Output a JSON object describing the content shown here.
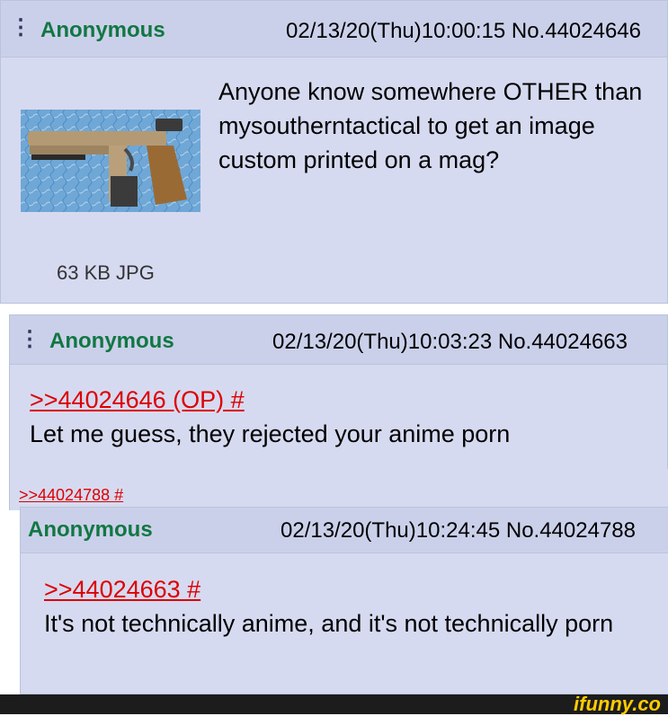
{
  "posts": [
    {
      "name": "Anonymous",
      "datetime": "02/13/20(Thu)10:00:15",
      "number": "No.44024646",
      "text": "Anyone know somewhere OTHER than mysoutherntactical to get an image custom printed on a mag?",
      "file": "63 KB JPG"
    },
    {
      "name": "Anonymous",
      "datetime": "02/13/20(Thu)10:03:23",
      "number": "No.44024663",
      "quote": ">>44024646 (OP) #",
      "text": "Let me guess, they rejected your anime porn",
      "backlink": ">>44024788 #"
    },
    {
      "name": "Anonymous",
      "datetime": "02/13/20(Thu)10:24:45",
      "number": "No.44024788",
      "quote": ">>44024663 #",
      "text": "It's not technically anime, and it's not technically porn"
    }
  ],
  "ui": {
    "menu_glyph": "⋮",
    "watermark": "ifunny.co"
  },
  "colors": {
    "post_bg": "#d6daf0",
    "name": "#117743",
    "quote": "#dd0000",
    "border": "#b7c5d9"
  }
}
